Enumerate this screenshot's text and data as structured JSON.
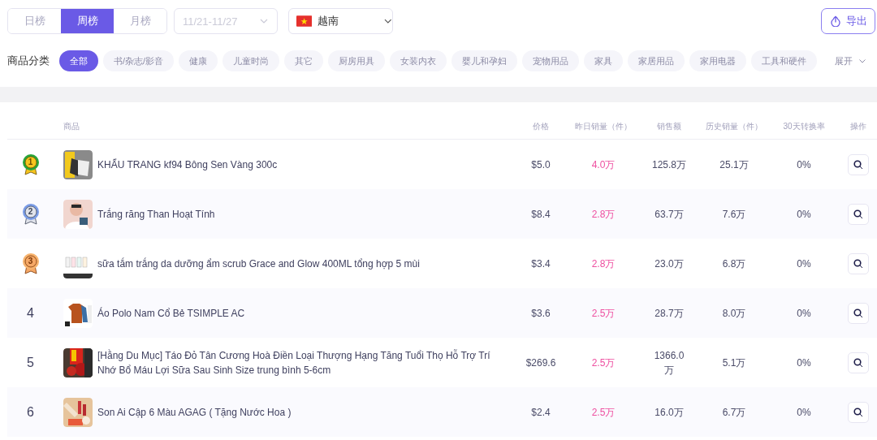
{
  "period_tabs": [
    {
      "label": "日榜",
      "selected": false
    },
    {
      "label": "周榜",
      "selected": true
    },
    {
      "label": "月榜",
      "selected": false
    }
  ],
  "date_range": {
    "placeholder": "11/21-11/27"
  },
  "country_select": {
    "value": "越南"
  },
  "export_button": {
    "label": "导出"
  },
  "category_filter": {
    "label": "商品分类",
    "expand_label": "展开",
    "categories": [
      {
        "label": "全部",
        "selected": true
      },
      {
        "label": "书/杂志/影音",
        "selected": false
      },
      {
        "label": "健康",
        "selected": false
      },
      {
        "label": "儿童时尚",
        "selected": false
      },
      {
        "label": "其它",
        "selected": false
      },
      {
        "label": "厨房用具",
        "selected": false
      },
      {
        "label": "女装内衣",
        "selected": false
      },
      {
        "label": "婴儿和孕妇",
        "selected": false
      },
      {
        "label": "宠物用品",
        "selected": false
      },
      {
        "label": "家具",
        "selected": false
      },
      {
        "label": "家居用品",
        "selected": false
      },
      {
        "label": "家用电器",
        "selected": false
      },
      {
        "label": "工具和硬件",
        "selected": false
      }
    ]
  },
  "table": {
    "columns": [
      "商品",
      "价格",
      "昨日销量（件）",
      "销售额",
      "历史销量（件）",
      "30天转换率",
      "操作"
    ],
    "rows": [
      {
        "rank": "1",
        "kind": "gold",
        "product": "KHẨU TRANG kf94 Bông Sen Vàng 300c",
        "price": "$5.0",
        "yesterday_sales": "4.0万",
        "revenue": "125.8万",
        "total_sales": "25.1万",
        "conversion_30d": "0%"
      },
      {
        "rank": "2",
        "kind": "silver",
        "product": "Trắng răng Than Hoạt Tính",
        "price": "$8.4",
        "yesterday_sales": "2.8万",
        "revenue": "63.7万",
        "total_sales": "7.6万",
        "conversion_30d": "0%"
      },
      {
        "rank": "3",
        "kind": "bronze",
        "product": "sữa tắm trắng da dưỡng ẩm scrub Grace and Glow 400ML tổng hợp 5 mùi",
        "price": "$3.4",
        "yesterday_sales": "2.8万",
        "revenue": "23.0万",
        "total_sales": "6.8万",
        "conversion_30d": "0%"
      },
      {
        "rank": "4",
        "kind": "plain",
        "product": "Áo Polo Nam Cổ Bẻ TSIMPLE AC",
        "price": "$3.6",
        "yesterday_sales": "2.5万",
        "revenue": "28.7万",
        "total_sales": "8.0万",
        "conversion_30d": "0%"
      },
      {
        "rank": "5",
        "kind": "plain",
        "product": "[Hằng Du Mục] Táo Đỏ Tân Cương Hoà Điền Loại Thượng Hạng Tăng Tuổi Thọ Hỗ Trợ Trí Nhớ Bổ Máu Lợi Sữa Sau Sinh Size trung bình 5-6cm",
        "price": "$269.6",
        "yesterday_sales": "2.5万",
        "revenue": "1366.0万",
        "total_sales": "5.1万",
        "conversion_30d": "0%"
      },
      {
        "rank": "6",
        "kind": "plain",
        "product": "Son Ai Cập 6 Màu AGAG ( Tặng Nước Hoa )",
        "price": "$2.4",
        "yesterday_sales": "2.5万",
        "revenue": "16.0万",
        "total_sales": "6.7万",
        "conversion_30d": "0%"
      }
    ]
  }
}
